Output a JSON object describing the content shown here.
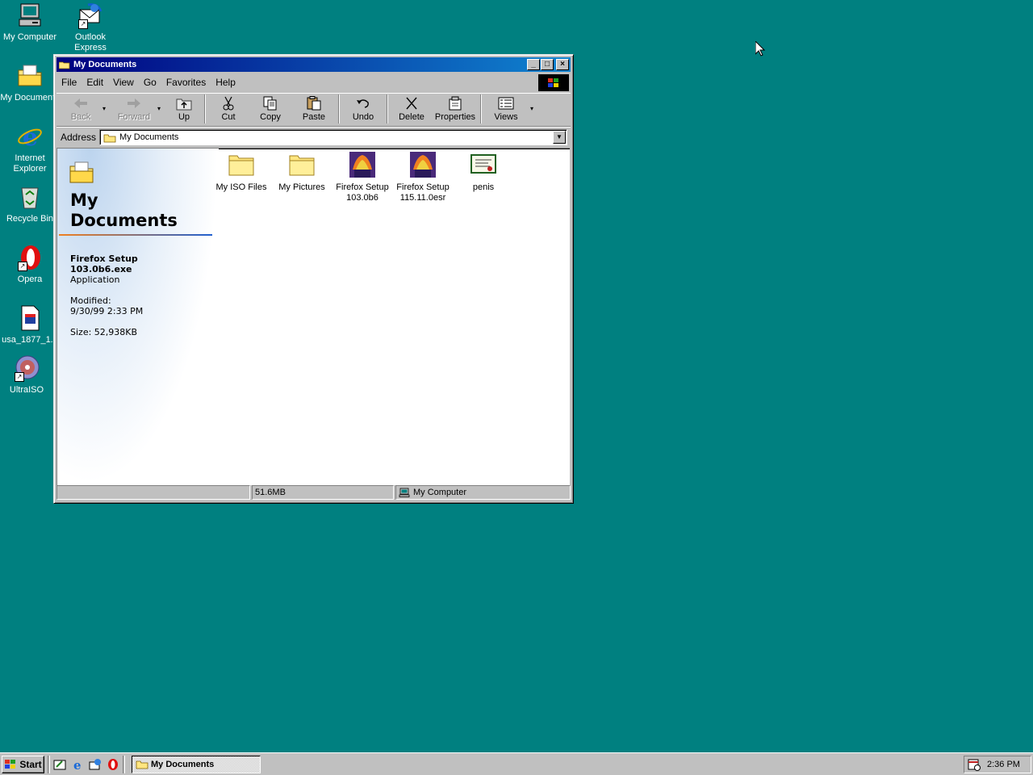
{
  "desktop": {
    "icons": [
      {
        "label": "My Computer",
        "icon": "computer-icon"
      },
      {
        "label": "Outlook Express",
        "label_line2": "Express",
        "label_line1": "Outlook",
        "icon": "outlook-express-icon"
      },
      {
        "label": "My Documents",
        "icon": "folder-icon"
      },
      {
        "label": "Internet",
        "label_line2": "Explorer",
        "icon": "internet-explorer-icon"
      },
      {
        "label": "Recycle Bin",
        "icon": "recycle-bin-icon"
      },
      {
        "label": "Opera",
        "icon": "opera-icon"
      },
      {
        "label": "usa_1877_1...",
        "icon": "document-icon"
      },
      {
        "label": "UltraISO",
        "icon": "ultraiso-icon"
      }
    ]
  },
  "window": {
    "title": "My Documents",
    "menu": [
      "File",
      "Edit",
      "View",
      "Go",
      "Favorites",
      "Help"
    ],
    "toolbar": {
      "back": "Back",
      "forward": "Forward",
      "up": "Up",
      "cut": "Cut",
      "copy": "Copy",
      "paste": "Paste",
      "undo": "Undo",
      "delete": "Delete",
      "properties": "Properties",
      "views": "Views"
    },
    "address": {
      "label": "Address",
      "value": "My Documents"
    },
    "webview": {
      "title_line1": "My",
      "title_line2": "Documents",
      "selected_name_line1": "Firefox Setup",
      "selected_name_line2": "103.0b6.exe",
      "selected_type": "Application",
      "modified_label": "Modified:",
      "modified_value": "9/30/99 2:33 PM",
      "size_text": "Size: 52,938KB"
    },
    "files": [
      {
        "line1": "My ISO Files",
        "line2": "",
        "icon": "folder-icon"
      },
      {
        "line1": "My Pictures",
        "line2": "",
        "icon": "folder-icon"
      },
      {
        "line1": "Firefox Setup",
        "line2": "103.0b6",
        "icon": "firefox-setup-icon"
      },
      {
        "line1": "Firefox Setup",
        "line2": "115.11.0esr",
        "icon": "firefox-setup-icon"
      },
      {
        "line1": "penis",
        "line2": "",
        "icon": "certificate-icon"
      }
    ],
    "status": {
      "size": "51.6MB",
      "zone": "My Computer"
    }
  },
  "taskbar": {
    "start": "Start",
    "task": "My Documents",
    "clock": "2:36 PM"
  },
  "colors": {
    "desktop": "#008080",
    "titlebar": "#000080",
    "face": "#c0c0c0"
  }
}
